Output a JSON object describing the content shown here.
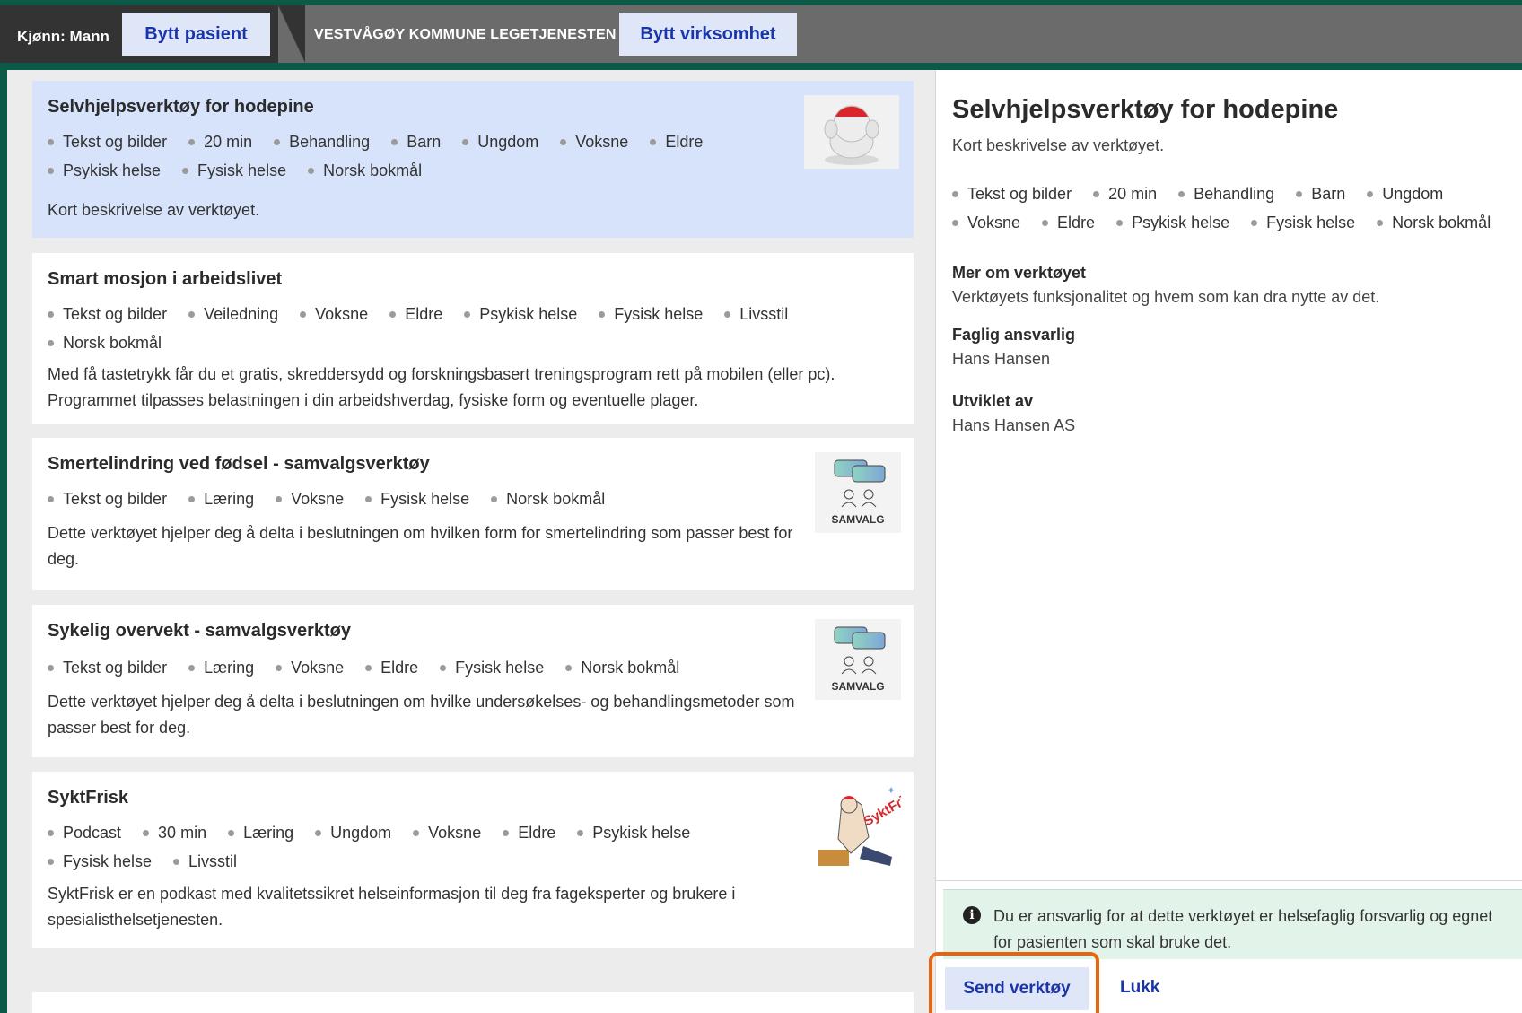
{
  "topbar": {
    "gender": "Kjønn: Mann",
    "switch_patient": "Bytt pasient",
    "organization": "VESTVÅGØY KOMMUNE LEGETJENESTEN",
    "switch_business": "Bytt virksomhet"
  },
  "colors": {
    "frame": "#0b5a48",
    "accent_button_bg": "#dfe6f7",
    "accent_text": "#1a35a8",
    "active_card": "#d7e3fb",
    "notice_bg": "#e2f3ea",
    "highlight": "#e8650f"
  },
  "tools": [
    {
      "title": "Selvhjelpsverktøy for hodepine",
      "tags": [
        "Tekst og bilder",
        "20 min",
        "Behandling",
        "Barn",
        "Ungdom",
        "Voksne",
        "Eldre",
        "Psykisk helse",
        "Fysisk helse",
        "Norsk bokmål"
      ],
      "description": "Kort beskrivelse av verktøyet.",
      "thumb_icon": "headache-figure-icon",
      "selected": true
    },
    {
      "title": "Smart mosjon i arbeidslivet",
      "tags": [
        "Tekst og bilder",
        "Veiledning",
        "Voksne",
        "Eldre",
        "Psykisk helse",
        "Fysisk helse",
        "Livsstil",
        "Norsk bokmål"
      ],
      "description_lines": [
        "Med få tastetrykk får du et gratis, skreddersydd og forskningsbasert treningsprogram rett på mobilen (eller pc).",
        "Programmet tilpasses belastningen i din arbeidshverdag, fysiske form og eventuelle plager."
      ]
    },
    {
      "title": "Smertelindring ved fødsel - samvalgsverktøy",
      "tags": [
        "Tekst og bilder",
        "Læring",
        "Voksne",
        "Fysisk helse",
        "Norsk bokmål"
      ],
      "description_lines": [
        "Dette verktøyet hjelper deg å delta i beslutningen om hvilken form for smertelindring som passer best for",
        "deg."
      ],
      "thumb_label": "SAMVALG"
    },
    {
      "title": "Sykelig overvekt - samvalgsverktøy",
      "tags": [
        "Tekst og bilder",
        "Læring",
        "Voksne",
        "Eldre",
        "Fysisk helse",
        "Norsk bokmål"
      ],
      "description_lines": [
        "Dette verktøyet hjelper deg å delta i beslutningen om hvilke undersøkelses- og behandlingsmetoder som",
        "passer best for deg."
      ],
      "thumb_label": "SAMVALG"
    },
    {
      "title": "SyktFrisk",
      "tags": [
        "Podcast",
        "30 min",
        "Læring",
        "Ungdom",
        "Voksne",
        "Eldre",
        "Psykisk helse",
        "Fysisk helse",
        "Livsstil"
      ],
      "description_lines": [
        "SyktFrisk er en podkast med kvalitetssikret helseinformasjon til deg fra fageksperter og brukere i",
        "spesialisthelsetjenesten."
      ],
      "thumb_label": "SyktFrisk"
    }
  ],
  "detail": {
    "title": "Selvhjelpsverktøy for hodepine",
    "subtitle": "Kort beskrivelse av verktøyet.",
    "tags": [
      "Tekst og bilder",
      "20 min",
      "Behandling",
      "Barn",
      "Ungdom",
      "Voksne",
      "Eldre",
      "Psykisk helse",
      "Fysisk helse",
      "Norsk bokmål"
    ],
    "more_label": "Mer om verktøyet",
    "more_value": "Verktøyets funksjonalitet og hvem som kan dra nytte av det.",
    "responsible_label": "Faglig ansvarlig",
    "responsible_value": "Hans Hansen",
    "developer_label": "Utviklet av",
    "developer_value": "Hans Hansen AS",
    "notice": "Du er ansvarlig for at dette verktøyet er helsefaglig forsvarlig og egnet for pasienten som skal bruke det.",
    "send_label": "Send verktøy",
    "close_label": "Lukk"
  }
}
